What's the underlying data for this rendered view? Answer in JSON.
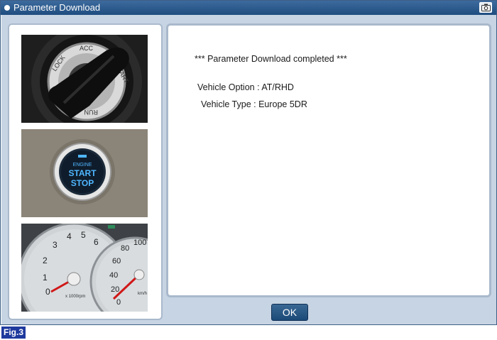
{
  "window": {
    "title": "Parameter Download"
  },
  "messages": {
    "status": "*** Parameter Download completed ***",
    "vehicle_option": "Vehicle Option : AT/RHD",
    "vehicle_type": "Vehicle Type : Europe 5DR"
  },
  "photos": {
    "ignition_ring": [
      "LOCK",
      "ACC",
      "START",
      "RUN"
    ],
    "start_button": [
      "ENGINE",
      "START",
      "STOP"
    ],
    "tachometer_ticks": [
      "1",
      "2",
      "3",
      "4",
      "5",
      "6",
      "0"
    ],
    "tachometer_unit": "x 1000rpm",
    "speedometer_ticks": [
      "80",
      "100",
      "60",
      "40",
      "20",
      "0"
    ],
    "speedometer_unit": "km/h"
  },
  "buttons": {
    "ok_label": "OK"
  },
  "figure": {
    "label": "Fig.3"
  },
  "colors": {
    "titlebar": "#2a5a8c",
    "panel_border": "#a9b9cc",
    "background": "#c7d4e3",
    "ok_button": "#2a5a8c",
    "fig_label": "#1f3a9e"
  }
}
